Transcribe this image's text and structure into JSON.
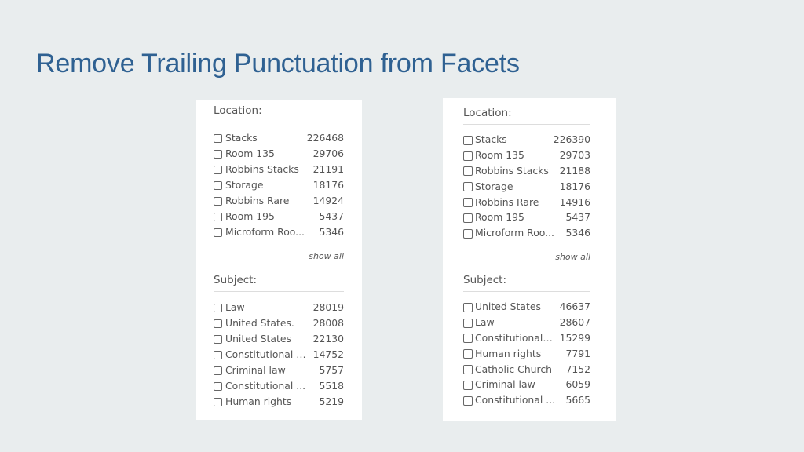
{
  "slide": {
    "title": "Remove Trailing Punctuation from Facets"
  },
  "before": {
    "location": {
      "heading": "Location:",
      "items": [
        {
          "label": "Stacks",
          "count": "226468"
        },
        {
          "label": "Room 135",
          "count": "29706"
        },
        {
          "label": "Robbins Stacks",
          "count": "21191"
        },
        {
          "label": "Storage",
          "count": "18176"
        },
        {
          "label": "Robbins Rare",
          "count": "14924"
        },
        {
          "label": "Room 195",
          "count": "5437"
        },
        {
          "label": "Microform Roo...",
          "count": "5346"
        }
      ],
      "show_all": "show all"
    },
    "subject": {
      "heading": "Subject:",
      "items": [
        {
          "label": "Law",
          "count": "28019"
        },
        {
          "label": "United States.",
          "count": "28008"
        },
        {
          "label": "United States",
          "count": "22130"
        },
        {
          "label": "Constitutional l...",
          "count": "14752"
        },
        {
          "label": "Criminal law",
          "count": "5757"
        },
        {
          "label": "Constitutional ...",
          "count": "5518"
        },
        {
          "label": "Human rights",
          "count": "5219"
        }
      ]
    }
  },
  "after": {
    "location": {
      "heading": "Location:",
      "items": [
        {
          "label": "Stacks",
          "count": "226390"
        },
        {
          "label": "Room 135",
          "count": "29703"
        },
        {
          "label": "Robbins Stacks",
          "count": "21188"
        },
        {
          "label": "Storage",
          "count": "18176"
        },
        {
          "label": "Robbins Rare",
          "count": "14916"
        },
        {
          "label": "Room 195",
          "count": "5437"
        },
        {
          "label": "Microform Roo...",
          "count": "5346"
        }
      ],
      "show_all": "show all"
    },
    "subject": {
      "heading": "Subject:",
      "items": [
        {
          "label": "United States",
          "count": "46637"
        },
        {
          "label": "Law",
          "count": "28607"
        },
        {
          "label": "Constitutional l...",
          "count": "15299"
        },
        {
          "label": "Human rights",
          "count": "7791"
        },
        {
          "label": "Catholic Church",
          "count": "7152"
        },
        {
          "label": "Criminal law",
          "count": "6059"
        },
        {
          "label": "Constitutional ...",
          "count": "5665"
        }
      ]
    }
  }
}
